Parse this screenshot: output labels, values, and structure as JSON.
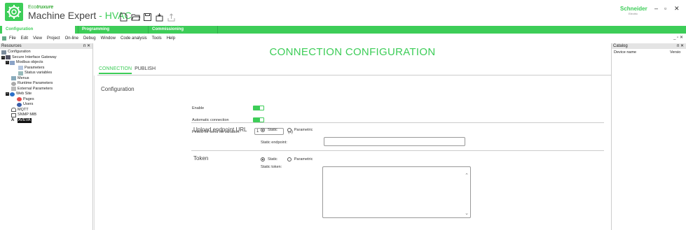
{
  "app": {
    "brand_prefix": "Eco",
    "brand_suffix": "truxure",
    "title_main": "Machine Expert",
    "title_accent": "- HVAC",
    "vendor": "Schneider",
    "vendor_sub": "Electric",
    "accent_color": "#3dcd58"
  },
  "window_controls": {
    "minimize": "–",
    "maximize": "▫",
    "close": "✕"
  },
  "toolbar_icons": [
    "new-file-icon",
    "open-folder-icon",
    "save-icon",
    "save-archive-icon",
    "export-icon"
  ],
  "ribbon": {
    "tabs": [
      {
        "label": "Configuration"
      },
      {
        "label": "Programming"
      },
      {
        "label": "Commissioning"
      }
    ]
  },
  "menu": {
    "items": [
      "File",
      "Edit",
      "View",
      "Project",
      "On-line",
      "Debug",
      "Window",
      "Code analysis",
      "Tools",
      "Help"
    ],
    "mdi_controls": "_ ▫ ✕"
  },
  "resources": {
    "title": "Resources",
    "controls": "ᴨ ✕",
    "tree": [
      {
        "label": "Configuration"
      },
      {
        "label": "Secure Interface Gateway"
      },
      {
        "label": "Modbus objects"
      },
      {
        "label": "Parameters"
      },
      {
        "label": "Status variables"
      },
      {
        "label": "Menus"
      },
      {
        "label": "Runtime Parameters"
      },
      {
        "label": "External Parameters"
      },
      {
        "label": "Web Site"
      },
      {
        "label": "Pages"
      },
      {
        "label": "Users"
      },
      {
        "label": "MQTT"
      },
      {
        "label": "SNMP MIB"
      },
      {
        "label": "AVEVA"
      }
    ]
  },
  "main": {
    "title": "CONNECTION CONFIGURATION",
    "subtabs": [
      "CONNECTION",
      "PUBLISH"
    ],
    "section_label": "Configuration",
    "enable_label": "Enable",
    "enable_on": true,
    "auto_conn_label": "Automatic connection",
    "auto_conn_on": true,
    "period_label": "Period for send on variation:",
    "period_value": "1",
    "period_unit": "(s)",
    "upload": {
      "title": "Upload endpoint URL",
      "option_static": "Static",
      "option_param": "Parametric",
      "selected": "Static",
      "endpoint_label": "Static endpoint:",
      "endpoint_value": ""
    },
    "token": {
      "title": "Token",
      "option_static": "Static",
      "option_param": "Parametric",
      "selected": "Static",
      "token_label": "Static token:",
      "token_value": ""
    }
  },
  "catalog": {
    "title": "Catalog",
    "controls": "ᴨ ✕",
    "columns": [
      "Device name",
      "Versio"
    ]
  }
}
